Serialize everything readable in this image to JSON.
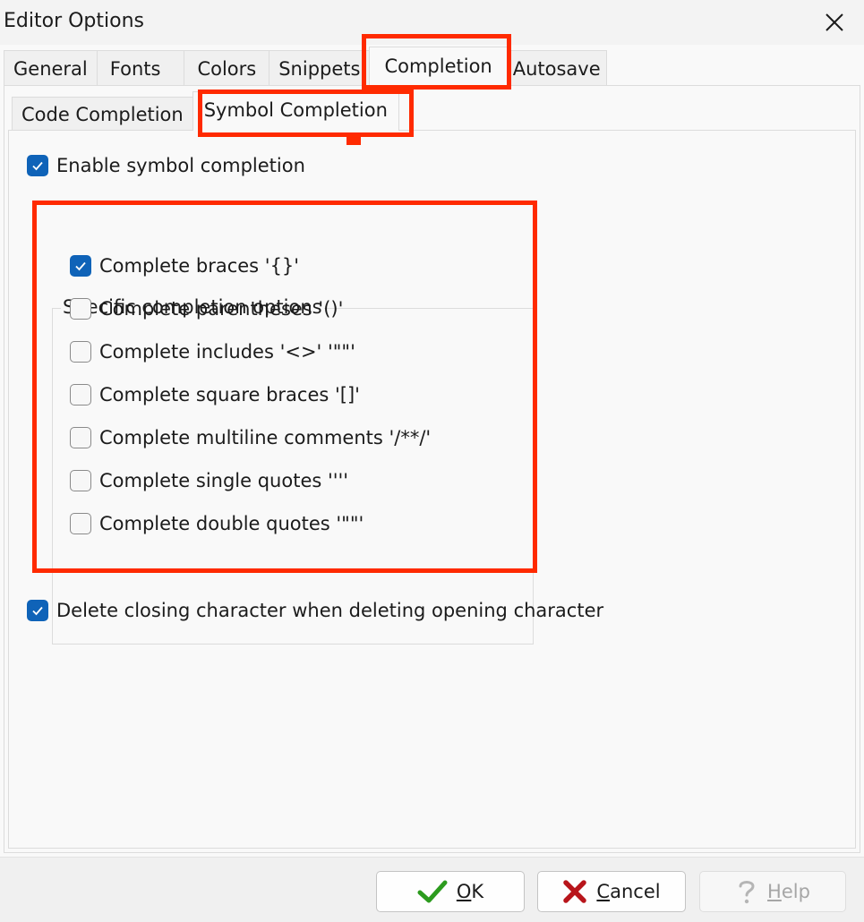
{
  "window": {
    "title": "Editor Options"
  },
  "outer_tabs": [
    {
      "label": "General"
    },
    {
      "label": "Fonts"
    },
    {
      "label": "Colors"
    },
    {
      "label": "Snippets"
    },
    {
      "label": "Completion",
      "active": true
    },
    {
      "label": "Autosave"
    }
  ],
  "inner_tabs": [
    {
      "label": "Code Completion"
    },
    {
      "label": "Symbol Completion",
      "active": true
    }
  ],
  "options": {
    "enable_symbol_completion": {
      "label": "Enable symbol completion",
      "checked": true
    },
    "group_title": "Specific completion options",
    "items": [
      {
        "label": "Complete braces '{}'",
        "checked": true
      },
      {
        "label": "Complete parentheses '()'",
        "checked": false
      },
      {
        "label": "Complete includes '<>' '\"\"'",
        "checked": false
      },
      {
        "label": "Complete square braces '[]'",
        "checked": false
      },
      {
        "label": "Complete multiline comments '/**/'",
        "checked": false
      },
      {
        "label": "Complete single quotes ''''",
        "checked": false
      },
      {
        "label": "Complete double quotes '\"\"'",
        "checked": false
      }
    ],
    "delete_closing": {
      "label": "Delete closing character when deleting opening character",
      "checked": true
    }
  },
  "buttons": {
    "ok": {
      "mnemonic": "O",
      "rest": "K"
    },
    "cancel": {
      "mnemonic": "C",
      "rest": "ancel"
    },
    "help": {
      "mnemonic": "H",
      "rest": "elp",
      "disabled": true
    }
  },
  "colors": {
    "highlight": "#ff2a00",
    "checkbox_accent": "#0f63b8"
  },
  "icons": {
    "close": "close-icon",
    "ok": "checkmark-icon",
    "cancel": "red-x-icon",
    "help": "question-mark-icon"
  }
}
